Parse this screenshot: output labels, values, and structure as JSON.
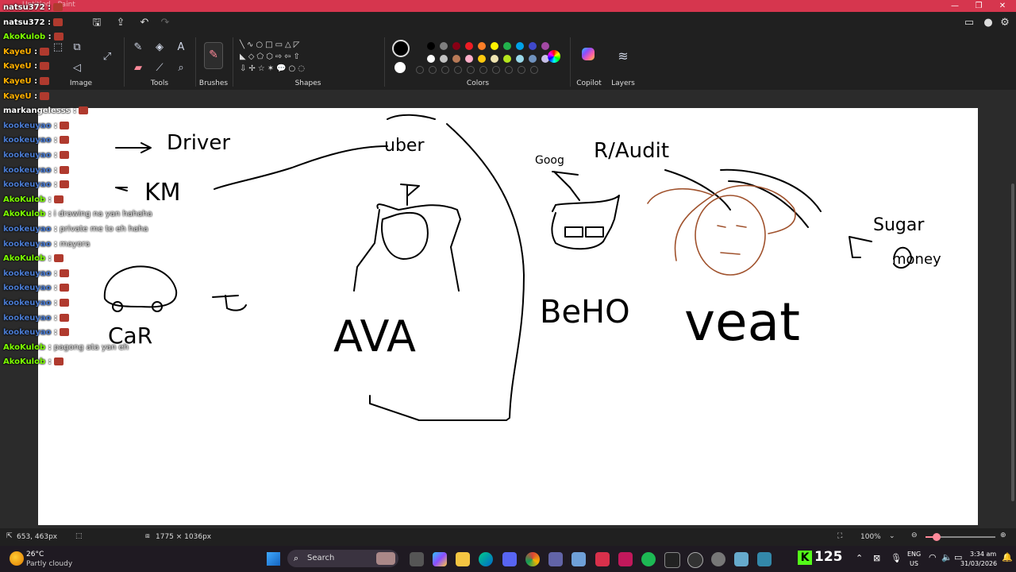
{
  "window": {
    "title": "Untitled - Paint"
  },
  "ribbon": {
    "groups": [
      "Image",
      "Tools",
      "Brushes",
      "Shapes",
      "Colors",
      "Copilot",
      "Layers"
    ]
  },
  "colors": {
    "row1": [
      "#000000",
      "#7f7f7f",
      "#880015",
      "#ed1c24",
      "#ff7f27",
      "#fff200",
      "#22b14c",
      "#00a2e8",
      "#3f48cc",
      "#a349a4"
    ],
    "row2": [
      "#ffffff",
      "#c3c3c3",
      "#b97a57",
      "#ffaec9",
      "#ffc90e",
      "#efe4b0",
      "#b5e61d",
      "#99d9ea",
      "#7092be",
      "#c8bfe7"
    ]
  },
  "canvas_text": {
    "driver": "Driver",
    "km": "KM",
    "uber": "uber",
    "ava": "AVA",
    "car": "CaR",
    "audit": "R/Audit",
    "beho": "BeHO",
    "veat": "veat",
    "sugar": "Sugar",
    "money": "money",
    "goog": "Goog"
  },
  "chat": [
    {
      "user": "natsu372",
      "sep": " :",
      "msg": "",
      "color": "#ffffff"
    },
    {
      "user": "natsu372",
      "sep": " :",
      "msg": "",
      "color": "#ffffff"
    },
    {
      "user": "AkoKulob",
      "sep": " :",
      "msg": "",
      "color": "#7cfc00"
    },
    {
      "user": "KayeU",
      "sep": " :",
      "msg": "",
      "color": "#ffb000"
    },
    {
      "user": "KayeU",
      "sep": " :",
      "msg": "",
      "color": "#ffb000"
    },
    {
      "user": "KayeU",
      "sep": " :",
      "msg": "",
      "color": "#ffb000"
    },
    {
      "user": "KayeU",
      "sep": " :",
      "msg": "",
      "color": "#ffb000"
    },
    {
      "user": "markangelesss",
      "sep": " :",
      "msg": "",
      "color": "#ffffff"
    },
    {
      "user": "kookeuyao",
      "sep": " :",
      "msg": "",
      "color": "#4a7bd1"
    },
    {
      "user": "kookeuyao",
      "sep": " :",
      "msg": "",
      "color": "#4a7bd1"
    },
    {
      "user": "kookeuyao",
      "sep": " :",
      "msg": "",
      "color": "#4a7bd1"
    },
    {
      "user": "kookeuyao",
      "sep": " :",
      "msg": "",
      "color": "#4a7bd1"
    },
    {
      "user": "kookeuyao",
      "sep": " :",
      "msg": "",
      "color": "#4a7bd1"
    },
    {
      "user": "AkoKulob",
      "sep": " :",
      "msg": "",
      "color": "#7cfc00"
    },
    {
      "user": "AkoKulob",
      "sep": " :",
      "msg": " i drawing na yan hahaha",
      "color": "#7cfc00"
    },
    {
      "user": "kookeuyao",
      "sep": " :",
      "msg": " private me to eh haha",
      "color": "#4a7bd1"
    },
    {
      "user": "kookeuyao",
      "sep": " :",
      "msg": " mayora",
      "color": "#4a7bd1"
    },
    {
      "user": "AkoKulob",
      "sep": " :",
      "msg": "",
      "color": "#7cfc00"
    },
    {
      "user": "kookeuyao",
      "sep": " :",
      "msg": "",
      "color": "#4a7bd1"
    },
    {
      "user": "kookeuyao",
      "sep": " :",
      "msg": "",
      "color": "#4a7bd1"
    },
    {
      "user": "kookeuyao",
      "sep": " :",
      "msg": "",
      "color": "#4a7bd1"
    },
    {
      "user": "kookeuyao",
      "sep": " :",
      "msg": "",
      "color": "#4a7bd1"
    },
    {
      "user": "kookeuyao",
      "sep": " :",
      "msg": "",
      "color": "#4a7bd1"
    },
    {
      "user": "AkoKulob",
      "sep": " :",
      "msg": " pagong ata yan eh",
      "color": "#7cfc00"
    },
    {
      "user": "AkoKulob",
      "sep": " :",
      "msg": "",
      "color": "#7cfc00"
    }
  ],
  "statusbar": {
    "cursor_pos": "653, 463px",
    "canvas_size": "1775 × 1036px",
    "zoom": "100%"
  },
  "taskbar": {
    "weather_temp": "26°C",
    "weather_desc": "Partly cloudy",
    "search_placeholder": "Search",
    "kick_count": "125",
    "lang": "ENG",
    "region": "US",
    "time": "3:34 am",
    "date": "31/03/2026"
  }
}
